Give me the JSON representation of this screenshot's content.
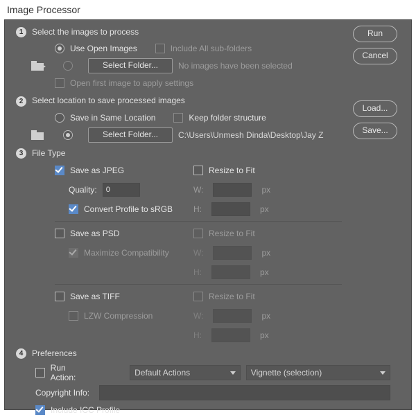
{
  "window": {
    "title": "Image Processor"
  },
  "buttons": {
    "run": "Run",
    "cancel": "Cancel",
    "load": "Load...",
    "save": "Save..."
  },
  "section1": {
    "title": "Select the images to process",
    "use_open_images": "Use Open Images",
    "include_subfolders": "Include All sub-folders",
    "select_folder_btn": "Select Folder...",
    "no_images": "No images have been selected",
    "open_first": "Open first image to apply settings"
  },
  "section2": {
    "title": "Select location to save processed images",
    "save_same": "Save in Same Location",
    "keep_structure": "Keep folder structure",
    "select_folder_btn": "Select Folder...",
    "path": "C:\\Users\\Unmesh Dinda\\Desktop\\Jay Z"
  },
  "section3": {
    "title": "File Type",
    "jpeg": {
      "save_as": "Save as JPEG",
      "quality_label": "Quality:",
      "quality_value": "0",
      "convert_srgb": "Convert Profile to sRGB",
      "resize": "Resize to Fit",
      "w": "W:",
      "h": "H:",
      "px": "px"
    },
    "psd": {
      "save_as": "Save as PSD",
      "max_compat": "Maximize Compatibility",
      "resize": "Resize to Fit",
      "w": "W:",
      "h": "H:",
      "px": "px"
    },
    "tiff": {
      "save_as": "Save as TIFF",
      "lzw": "LZW Compression",
      "resize": "Resize to Fit",
      "w": "W:",
      "h": "H:",
      "px": "px"
    }
  },
  "section4": {
    "title": "Preferences",
    "run_action": "Run Action:",
    "action_set": "Default Actions",
    "action_name": "Vignette (selection)",
    "copyright": "Copyright Info:",
    "include_icc": "Include ICC Profile"
  }
}
